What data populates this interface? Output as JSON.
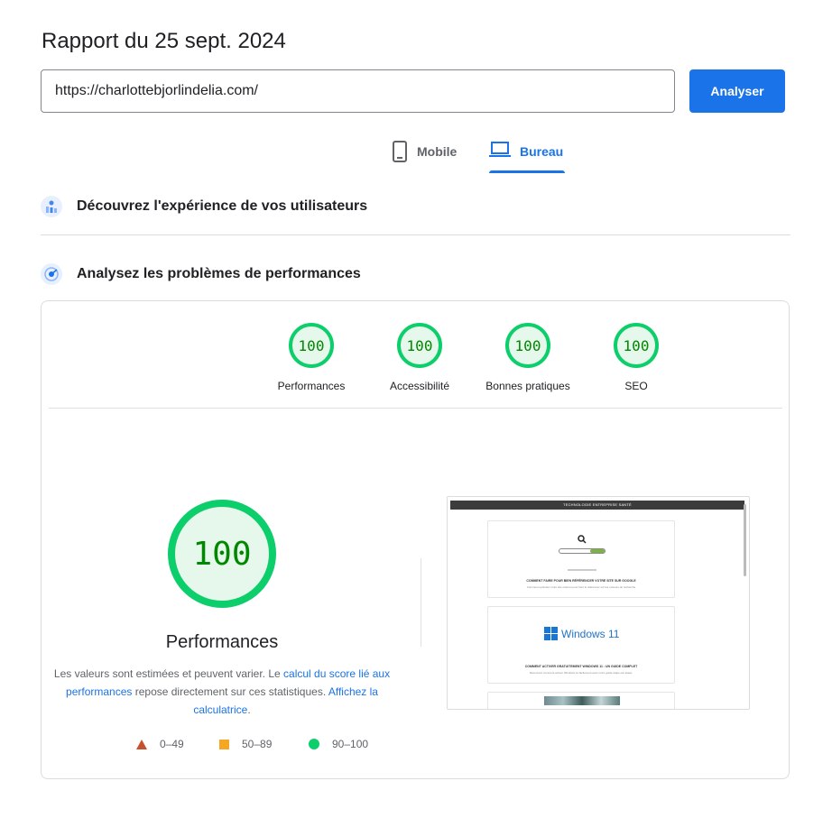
{
  "header": {
    "title": "Rapport du 25 sept. 2024",
    "url_value": "https://charlottebjorlindelia.com/",
    "analyze_label": "Analyser"
  },
  "tabs": {
    "mobile": "Mobile",
    "desktop": "Bureau",
    "active": "Bureau"
  },
  "sections": {
    "experience": "Découvrez l'expérience de vos utilisateurs",
    "diagnose": "Analysez les problèmes de performances"
  },
  "scores": [
    {
      "label": "Performances",
      "value": "100"
    },
    {
      "label": "Accessibilité",
      "value": "100"
    },
    {
      "label": "Bonnes pratiques",
      "value": "100"
    },
    {
      "label": "SEO",
      "value": "100"
    }
  ],
  "performance": {
    "score": "100",
    "label": "Performances",
    "note_prefix": "Les valeurs sont estimées et peuvent varier. Le ",
    "note_link1": "calcul du score lié aux performances",
    "note_middle": " repose directement sur ces statistiques. ",
    "note_link2": "Affichez la calculatrice",
    "note_suffix": "."
  },
  "legend": {
    "fail": "0–49",
    "average": "50–89",
    "pass": "90–100"
  },
  "screenshot": {
    "nav": "TECHNOLOGIE   ENTREPRISE   SANTÉ",
    "post1_title": "COMMENT FAIRE POUR BIEN RÉFÉRENCER VOTRE SITE SUR GOOGLE",
    "post1_desc": "Comment optimiser votre site internet pour bien le référencer sur les moteurs de recherche",
    "post2_logo": "Windows 11",
    "post2_title": "COMMENT ACTIVER GRATUITEMENT WINDOWS 11 : UN GUIDE COMPLET",
    "post2_desc": "Découvrez comment activer Windows 11 facilement avec notre guide étape par étape."
  },
  "colors": {
    "accent": "#1a73e8",
    "pass": "#0cce6b",
    "average": "#f5a623",
    "fail": "#c7502f"
  }
}
